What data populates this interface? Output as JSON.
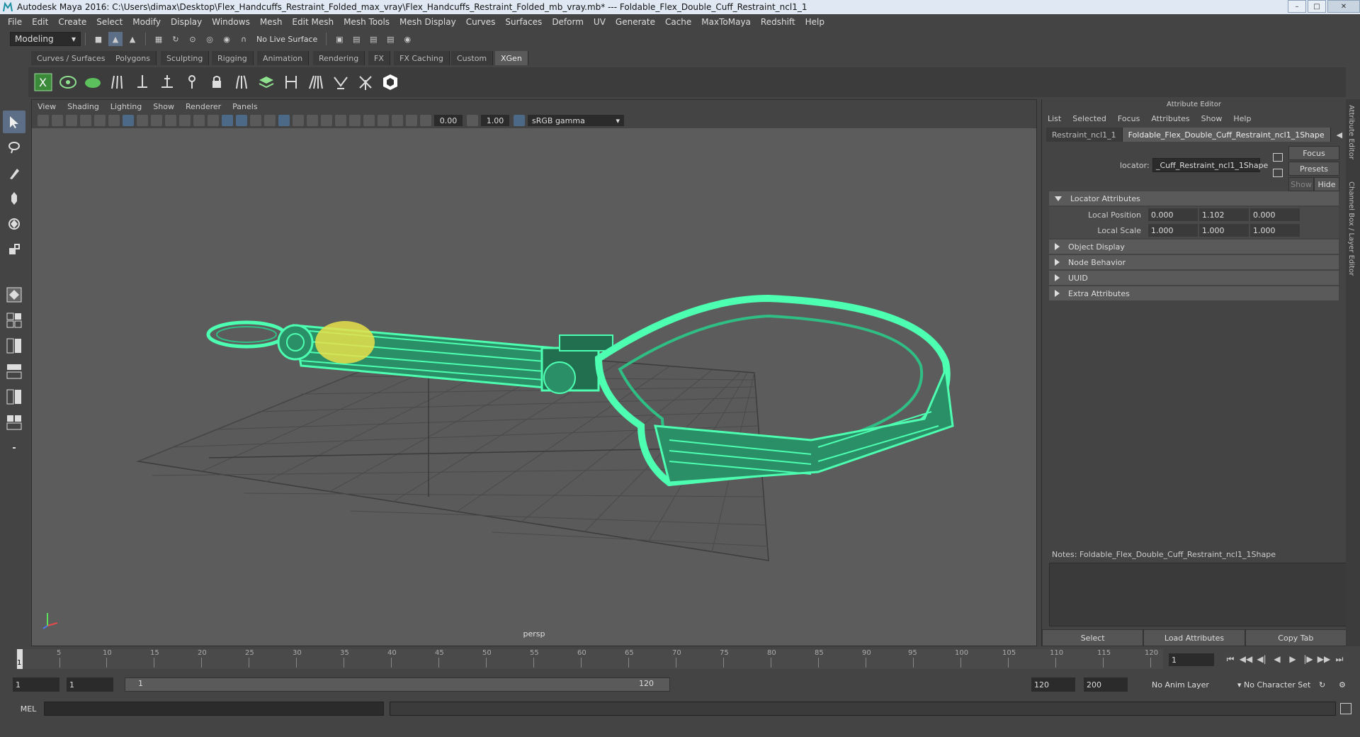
{
  "window": {
    "title": "Autodesk Maya 2016: C:\\Users\\dimax\\Desktop\\Flex_Handcuffs_Restraint_Folded_max_vray\\Flex_Handcuffs_Restraint_Folded_mb_vray.mb*   ---   Foldable_Flex_Double_Cuff_Restraint_ncl1_1"
  },
  "menubar": [
    "File",
    "Edit",
    "Create",
    "Select",
    "Modify",
    "Display",
    "Windows",
    "Mesh",
    "Edit Mesh",
    "Mesh Tools",
    "Mesh Display",
    "Curves",
    "Surfaces",
    "Deform",
    "UV",
    "Generate",
    "Cache",
    "MaxToMaya",
    "Redshift",
    "Help"
  ],
  "statusline": {
    "mode": "Modeling",
    "live_surface": "No Live Surface"
  },
  "shelf": {
    "tabs": [
      "Curves / Surfaces",
      "Polygons",
      "Sculpting",
      "Rigging",
      "Animation",
      "Rendering",
      "FX",
      "FX Caching",
      "Custom",
      "XGen"
    ],
    "active_tab": "XGen"
  },
  "viewport": {
    "menu": [
      "View",
      "Shading",
      "Lighting",
      "Show",
      "Renderer",
      "Panels"
    ],
    "exposure": "0.00",
    "gamma": "1.00",
    "color_space": "sRGB gamma",
    "camera_label": "persp",
    "wire_color": "#4dffb0",
    "highlight_color": "#e8e04a"
  },
  "attribute_editor": {
    "title": "Attribute Editor",
    "menu": [
      "List",
      "Selected",
      "Focus",
      "Attributes",
      "Show",
      "Help"
    ],
    "tabs": [
      "Restraint_ncl1_1",
      "Foldable_Flex_Double_Cuff_Restraint_ncl1_1Shape"
    ],
    "node_type_label": "locator:",
    "node_name": "_Cuff_Restraint_ncl1_1Shape",
    "buttons": {
      "focus": "Focus",
      "presets": "Presets",
      "show": "Show",
      "hide": "Hide"
    },
    "sections": {
      "locator_attributes": "Locator Attributes",
      "object_display": "Object Display",
      "node_behavior": "Node Behavior",
      "uuid": "UUID",
      "extra_attributes": "Extra Attributes"
    },
    "local_position": {
      "label": "Local Position",
      "x": "0.000",
      "y": "1.102",
      "z": "0.000"
    },
    "local_scale": {
      "label": "Local Scale",
      "x": "1.000",
      "y": "1.000",
      "z": "1.000"
    },
    "notes_label": "Notes:  Foldable_Flex_Double_Cuff_Restraint_ncl1_1Shape",
    "bottom_buttons": [
      "Select",
      "Load Attributes",
      "Copy Tab"
    ]
  },
  "side_tabs": [
    "Attribute Editor",
    "Channel Box / Layer Editor"
  ],
  "timeline": {
    "ticks": [
      "5",
      "10",
      "15",
      "20",
      "25",
      "30",
      "35",
      "40",
      "45",
      "50",
      "55",
      "60",
      "65",
      "70",
      "75",
      "80",
      "85",
      "90",
      "95",
      "100",
      "105",
      "110",
      "115",
      "120"
    ],
    "current_frame": "1",
    "current_frame_field": "1"
  },
  "range": {
    "start_field": "1",
    "anim_start_field": "1",
    "range_start": "1",
    "range_end": "120",
    "end_field": "120",
    "anim_end_field": "200",
    "anim_layer": "No Anim Layer",
    "character_set": "No Character Set"
  },
  "command_line": {
    "label": "MEL"
  }
}
